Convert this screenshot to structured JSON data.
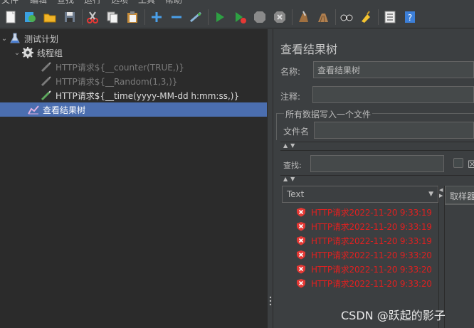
{
  "menubar": {
    "items": [
      "文件",
      "编辑",
      "查找",
      "运行",
      "选项",
      "工具",
      "帮助"
    ]
  },
  "toolbar": {
    "buttons": [
      "new-icon",
      "templates-icon",
      "open-icon",
      "save-icon",
      "cut-icon",
      "copy-icon",
      "paste-icon",
      "expand-icon",
      "collapse-icon",
      "toggle-icon",
      "start-icon",
      "start-no-pause-icon",
      "stop-icon",
      "shutdown-icon",
      "clear-icon",
      "clear-all-icon",
      "search-icon",
      "reset-search-icon",
      "function-helper-icon",
      "help-icon"
    ]
  },
  "tree": {
    "nodes": [
      {
        "label": "测试计划",
        "icon": "flask-icon"
      },
      {
        "label": "线程组",
        "icon": "gear-icon"
      },
      {
        "label": "HTTP请求${__counter(TRUE,)}",
        "icon": "pipette-icon",
        "disabled": true
      },
      {
        "label": "HTTP请求${__Random(1,3,)}",
        "icon": "pipette-icon",
        "disabled": true
      },
      {
        "label": "HTTP请求${__time(yyyy-MM-dd h:mm:ss,)}",
        "icon": "pipette-icon",
        "disabled": false
      },
      {
        "label": "查看结果树",
        "icon": "chart-icon",
        "selected": true
      }
    ]
  },
  "panel": {
    "title": "查看结果树",
    "name_label": "名称:",
    "name_value": "查看结果树",
    "comment_label": "注释:",
    "comment_value": "",
    "group_title": "所有数据写入一个文件",
    "filename_label": "文件名",
    "filename_value": "",
    "search_label": "查找:",
    "search_value": "",
    "checkbox_label": "区",
    "renderer": "Text",
    "tab_label": "取样器"
  },
  "results": [
    {
      "label": "HTTP请求2022-11-20 9:33:19"
    },
    {
      "label": "HTTP请求2022-11-20 9:33:19"
    },
    {
      "label": "HTTP请求2022-11-20 9:33:19"
    },
    {
      "label": "HTTP请求2022-11-20 9:33:20"
    },
    {
      "label": "HTTP请求2022-11-20 9:33:20"
    },
    {
      "label": "HTTP请求2022-11-20 9:33:20"
    }
  ],
  "watermark": "CSDN @跃起的影子",
  "colors": {
    "selection": "#4b6eaf",
    "error_text": "#e02020",
    "panel_bg": "#3c3f41",
    "tree_bg": "#2b2b2b"
  }
}
